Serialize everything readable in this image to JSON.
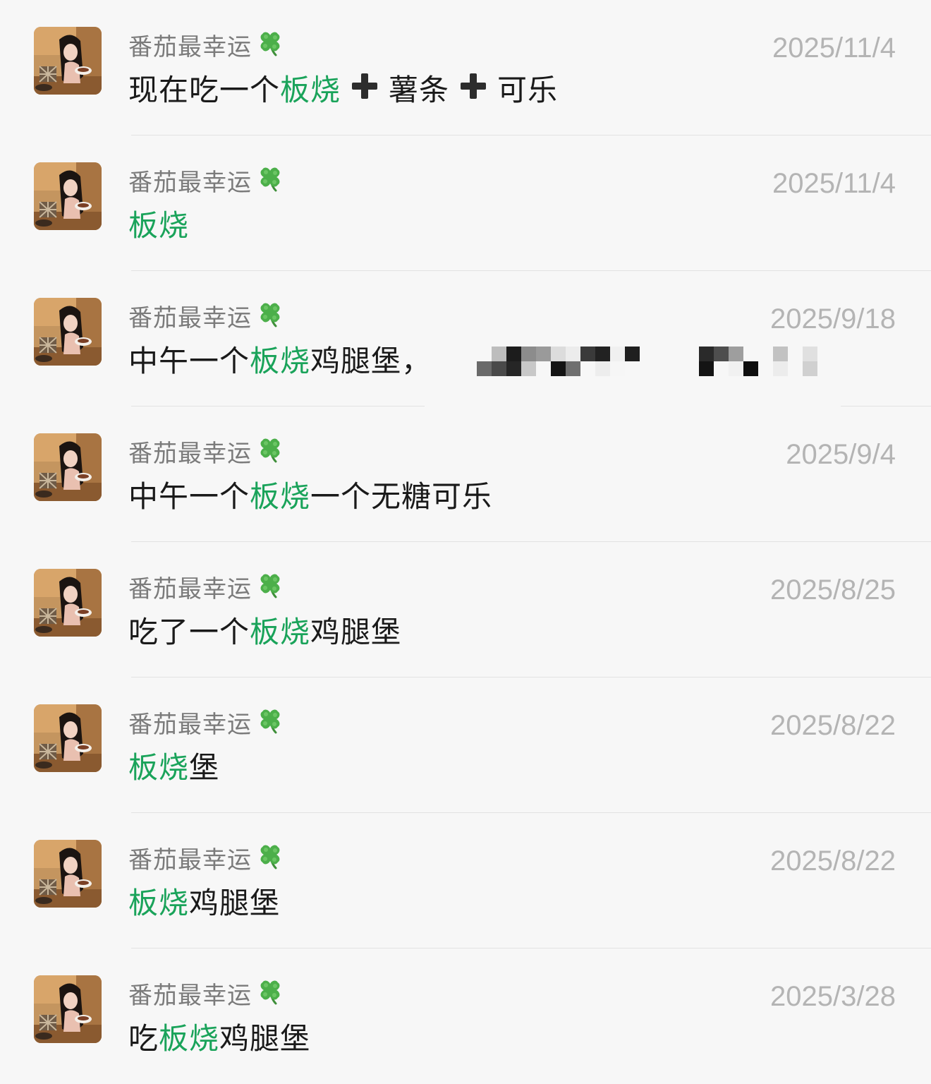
{
  "accent_color": "#1aa35a",
  "items": [
    {
      "user": "番茄最幸运",
      "badge_icon": "four-leaf-clover-icon",
      "date": "2025/11/4",
      "message": [
        {
          "t": "现在吃一个"
        },
        {
          "t": "板烧",
          "hl": true
        },
        {
          "icon": "heavy-plus-icon"
        },
        {
          "t": "薯条"
        },
        {
          "icon": "heavy-plus-icon"
        },
        {
          "t": "可乐"
        }
      ]
    },
    {
      "user": "番茄最幸运",
      "badge_icon": "four-leaf-clover-icon",
      "date": "2025/11/4",
      "message": [
        {
          "t": "板烧",
          "hl": true
        }
      ]
    },
    {
      "user": "番茄最幸运",
      "badge_icon": "four-leaf-clover-icon",
      "date": "2025/9/18",
      "redacted": true,
      "message": [
        {
          "t": "中午一个"
        },
        {
          "t": "板烧",
          "hl": true
        },
        {
          "t": "鸡腿堡，"
        }
      ]
    },
    {
      "user": "番茄最幸运",
      "badge_icon": "four-leaf-clover-icon",
      "date": "2025/9/4",
      "message": [
        {
          "t": "中午一个"
        },
        {
          "t": "板烧",
          "hl": true
        },
        {
          "t": "一个无糖可乐"
        }
      ]
    },
    {
      "user": "番茄最幸运",
      "badge_icon": "four-leaf-clover-icon",
      "date": "2025/8/25",
      "message": [
        {
          "t": "吃了一个"
        },
        {
          "t": "板烧",
          "hl": true
        },
        {
          "t": "鸡腿堡"
        }
      ]
    },
    {
      "user": "番茄最幸运",
      "badge_icon": "four-leaf-clover-icon",
      "date": "2025/8/22",
      "message": [
        {
          "t": "板烧",
          "hl": true
        },
        {
          "t": "堡"
        }
      ]
    },
    {
      "user": "番茄最幸运",
      "badge_icon": "four-leaf-clover-icon",
      "date": "2025/8/22",
      "message": [
        {
          "t": "板烧",
          "hl": true
        },
        {
          "t": "鸡腿堡"
        }
      ]
    },
    {
      "user": "番茄最幸运",
      "badge_icon": "four-leaf-clover-icon",
      "date": "2025/3/28",
      "message": [
        {
          "t": "吃"
        },
        {
          "t": "板烧",
          "hl": true
        },
        {
          "t": "鸡腿堡"
        }
      ]
    }
  ]
}
